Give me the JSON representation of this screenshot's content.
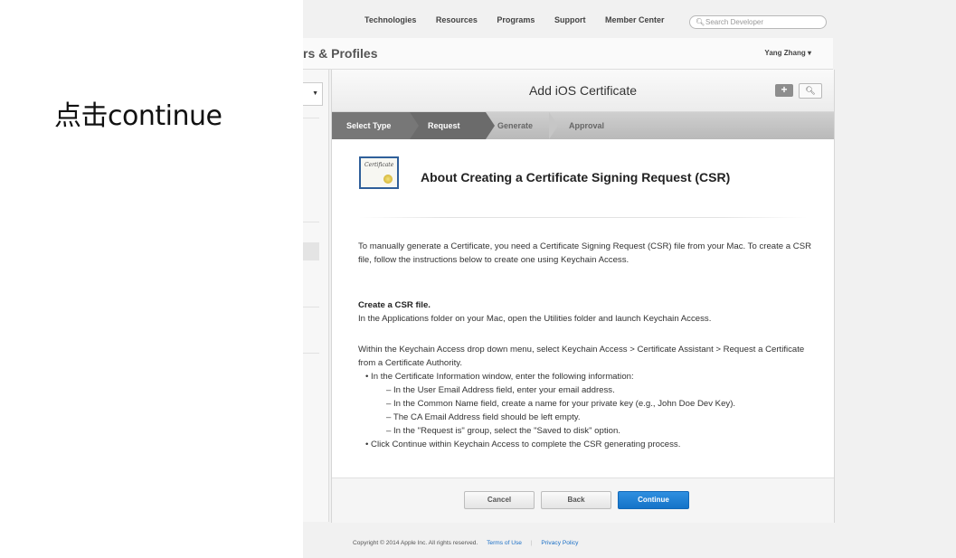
{
  "annotation": "点击continue",
  "topnav": {
    "links": [
      "Technologies",
      "Resources",
      "Programs",
      "Support",
      "Member Center"
    ],
    "search_placeholder": "Search Developer"
  },
  "header": {
    "title": "rs & Profiles",
    "user": "Yang Zhang ▾"
  },
  "panel": {
    "title": "Add iOS Certificate",
    "add_icon": "plus-icon",
    "search_icon": "search-icon",
    "steps": [
      "Select Type",
      "Request",
      "Generate",
      "Approval"
    ],
    "active_step": "Request",
    "cert_script": "Certificate",
    "heading": "About Creating a Certificate Signing Request (CSR)",
    "intro": "To manually generate a Certificate, you need a Certificate Signing Request (CSR) file from your Mac. To create a CSR file, follow the instructions below to create one using Keychain Access.",
    "csr_title": "Create a CSR file.",
    "csr_text": "In the Applications folder on your Mac, open the Utilities folder and launch Keychain Access.",
    "menu_text": "Within the Keychain Access drop down menu, select Keychain Access > Certificate Assistant > Request a Certificate from a Certificate Authority.",
    "bullet1": "• In the Certificate Information window, enter the following information:",
    "sub1": "– In the User Email Address field, enter your email address.",
    "sub2": "– In the Common Name field, create a name for your private key (e.g., John Doe Dev Key).",
    "sub3": "– The CA Email Address field should be left empty.",
    "sub4": "– In the \"Request is\" group, select the \"Saved to disk\" option.",
    "bullet2": "• Click Continue within Keychain Access to complete the CSR generating process.",
    "buttons": {
      "cancel": "Cancel",
      "back": "Back",
      "continue": "Continue"
    }
  },
  "footer": {
    "copyright": "Copyright © 2014 Apple Inc. All rights reserved.",
    "terms": "Terms of Use",
    "privacy": "Privacy Policy"
  }
}
